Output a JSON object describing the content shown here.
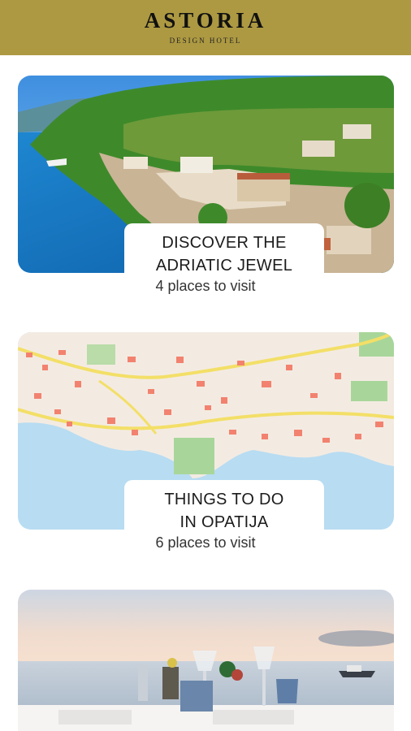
{
  "header": {
    "brand": "ASTORIA",
    "subtitle": "DESIGN HOTEL"
  },
  "cards": [
    {
      "title_line1": "DISCOVER THE",
      "title_line2": "ADRIATIC JEWEL",
      "count": "4 places to visit"
    },
    {
      "title_line1": "THINGS TO DO",
      "title_line2": "IN OPATIJA",
      "count": "6 places to visit"
    }
  ],
  "colors": {
    "header_bg": "#ad9942",
    "sea": "#1f7fc6",
    "map_water": "#b8dcf2"
  }
}
